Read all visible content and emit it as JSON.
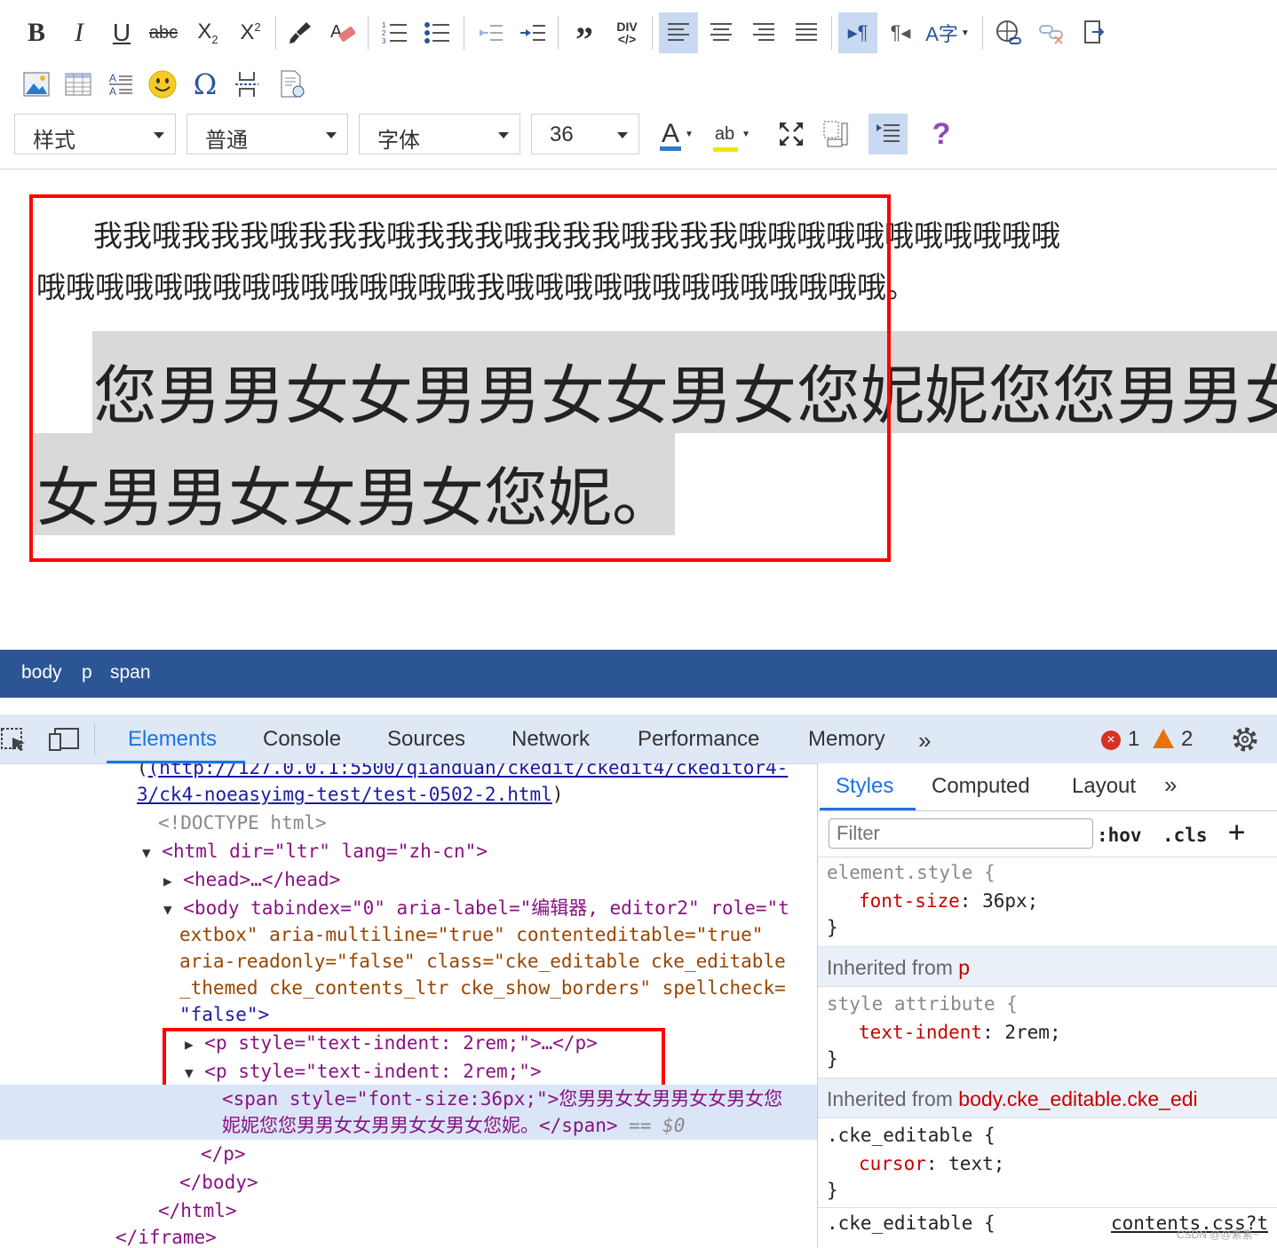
{
  "toolbar": {
    "row1": [
      "B",
      "I",
      "U",
      "abc",
      "X₂",
      "X²",
      "paintbrush-icon",
      "eraser-icon",
      "numbered-list-icon",
      "bullet-list-icon",
      "outdent-icon",
      "indent-icon",
      "blockquote-icon",
      "div-icon",
      "align-left-icon",
      "align-center-icon",
      "align-right-icon",
      "justify-icon",
      "ltr-icon",
      "rtl-icon",
      "language-icon",
      "link-icon",
      "unlink-icon",
      "anchor-icon"
    ],
    "superscript_mark": "2",
    "subscript_mark": "2",
    "div_label": "DIV",
    "div_code": "</>",
    "row2": [
      "image-icon",
      "table-icon",
      "hr-icon",
      "smiley-icon",
      "omega-icon",
      "pagebreak-icon",
      "template-icon"
    ],
    "omega": "Ω",
    "combos": {
      "style": "样式",
      "format": "普通",
      "font": "字体",
      "size": "36"
    },
    "font_color_letter": "A",
    "bg_color_letter": "ab",
    "help": "?"
  },
  "editor": {
    "p1_line1": "我我哦我我我哦我我我哦我我我哦我我我哦我我我哦哦哦哦哦哦哦哦哦哦哦",
    "p1_line2": "哦哦哦哦哦哦哦哦哦哦哦哦哦哦哦我哦哦哦哦哦哦哦哦哦哦哦哦哦。",
    "p2_line1": "您男男女女男男女女男女您妮妮您您男男女",
    "p2_line2": "女男男女女男女您妮。"
  },
  "statusbar": {
    "body": "body",
    "p": "p",
    "span": "span"
  },
  "devtools": {
    "tabs": [
      "Elements",
      "Console",
      "Sources",
      "Network",
      "Performance",
      "Memory"
    ],
    "errors": "1",
    "warnings": "2",
    "url_line1": "(http://127.0.0.1:5500/qianduan/ckedit/ckedit4/ckeditor4-",
    "url_line2": "3/ck4-noeasyimg-test/test-0502-2.html",
    "doctype": "<!DOCTYPE html>",
    "html_open": "<html dir=\"ltr\" lang=\"zh-cn\">",
    "head": "<head>…</head>",
    "body_l1": "<body tabindex=\"0\" aria-label=\"编辑器, editor2\" role=\"t",
    "body_l2": "extbox\" aria-multiline=\"true\" contenteditable=\"true\"",
    "body_l3": "aria-readonly=\"false\" class=\"cke_editable cke_editable",
    "body_l4": "_themed cke_contents_ltr cke_show_borders\" spellcheck=",
    "body_l5": "\"false\">",
    "p1": "<p style=\"text-indent: 2rem;\">…</p>",
    "p2": "<p style=\"text-indent: 2rem;\">",
    "span_l1": "<span style=\"font-size:36px;\">您男男女女男男女女男女您",
    "span_l2": "妮妮您您男男女女男男女女男女您妮。</span>",
    "selected_marker": "== $0",
    "p_close": "</p>",
    "body_close": "</body>",
    "html_close": "</html>",
    "iframe_close": "</iframe>"
  },
  "styles": {
    "tabs": [
      "Styles",
      "Computed",
      "Layout"
    ],
    "filter_placeholder": "Filter",
    "hov": ":hov",
    "cls": ".cls",
    "element_style": "element.style {",
    "rule1_prop": "font-size",
    "rule1_val": "36px;",
    "close_brace": "}",
    "inherited_p_prefix": "Inherited from",
    "inherited_p_tag": "p",
    "style_attribute": "style attribute {",
    "rule2_prop": "text-indent",
    "rule2_val": "2rem;",
    "inherited_body_prefix": "Inherited from",
    "inherited_body_sel": "body.cke_editable.cke_edi",
    "cke_sel": ".cke_editable {",
    "rule3_prop": "cursor",
    "rule3_val": "text;",
    "cke_sel2": ".cke_editable {",
    "source": "contents.css?t",
    "watermark": "CSDN @@素素~"
  },
  "colors": {
    "accent": "#1a73e8",
    "statusbar": "#2c5596",
    "highlight_red": "#ff0000",
    "selected_button": "#c9d9f2"
  }
}
